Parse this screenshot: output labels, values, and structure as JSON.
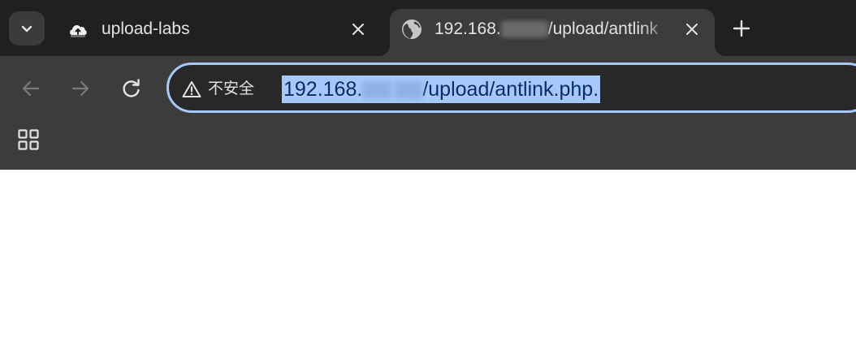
{
  "tabstrip": {
    "tabs": [
      {
        "title": "upload-labs",
        "favicon": "cloud-upload-icon",
        "active": false
      },
      {
        "title": "192.168.",
        "title_suffix": "/upload/antlink",
        "favicon": "globe-icon",
        "active": true
      }
    ],
    "search_tabs_icon": "chevron-down-icon",
    "close_icon": "close-icon",
    "new_tab_icon": "plus-icon"
  },
  "toolbar": {
    "back_icon": "arrow-left-icon",
    "forward_icon": "arrow-right-icon",
    "reload_icon": "reload-icon",
    "security_label": "不安全",
    "security_icon": "warning-triangle-icon",
    "url_prefix": "192.168.",
    "url_suffix": "/upload/antlink.php.",
    "apps_icon": "apps-grid-icon"
  },
  "colors": {
    "tabstrip_bg": "#1f2020",
    "toolbar_bg": "#3c3c3c",
    "omnibox_border": "#a8c7fa",
    "url_selection": "#a8c7fa",
    "text": "#e3e3e3"
  }
}
